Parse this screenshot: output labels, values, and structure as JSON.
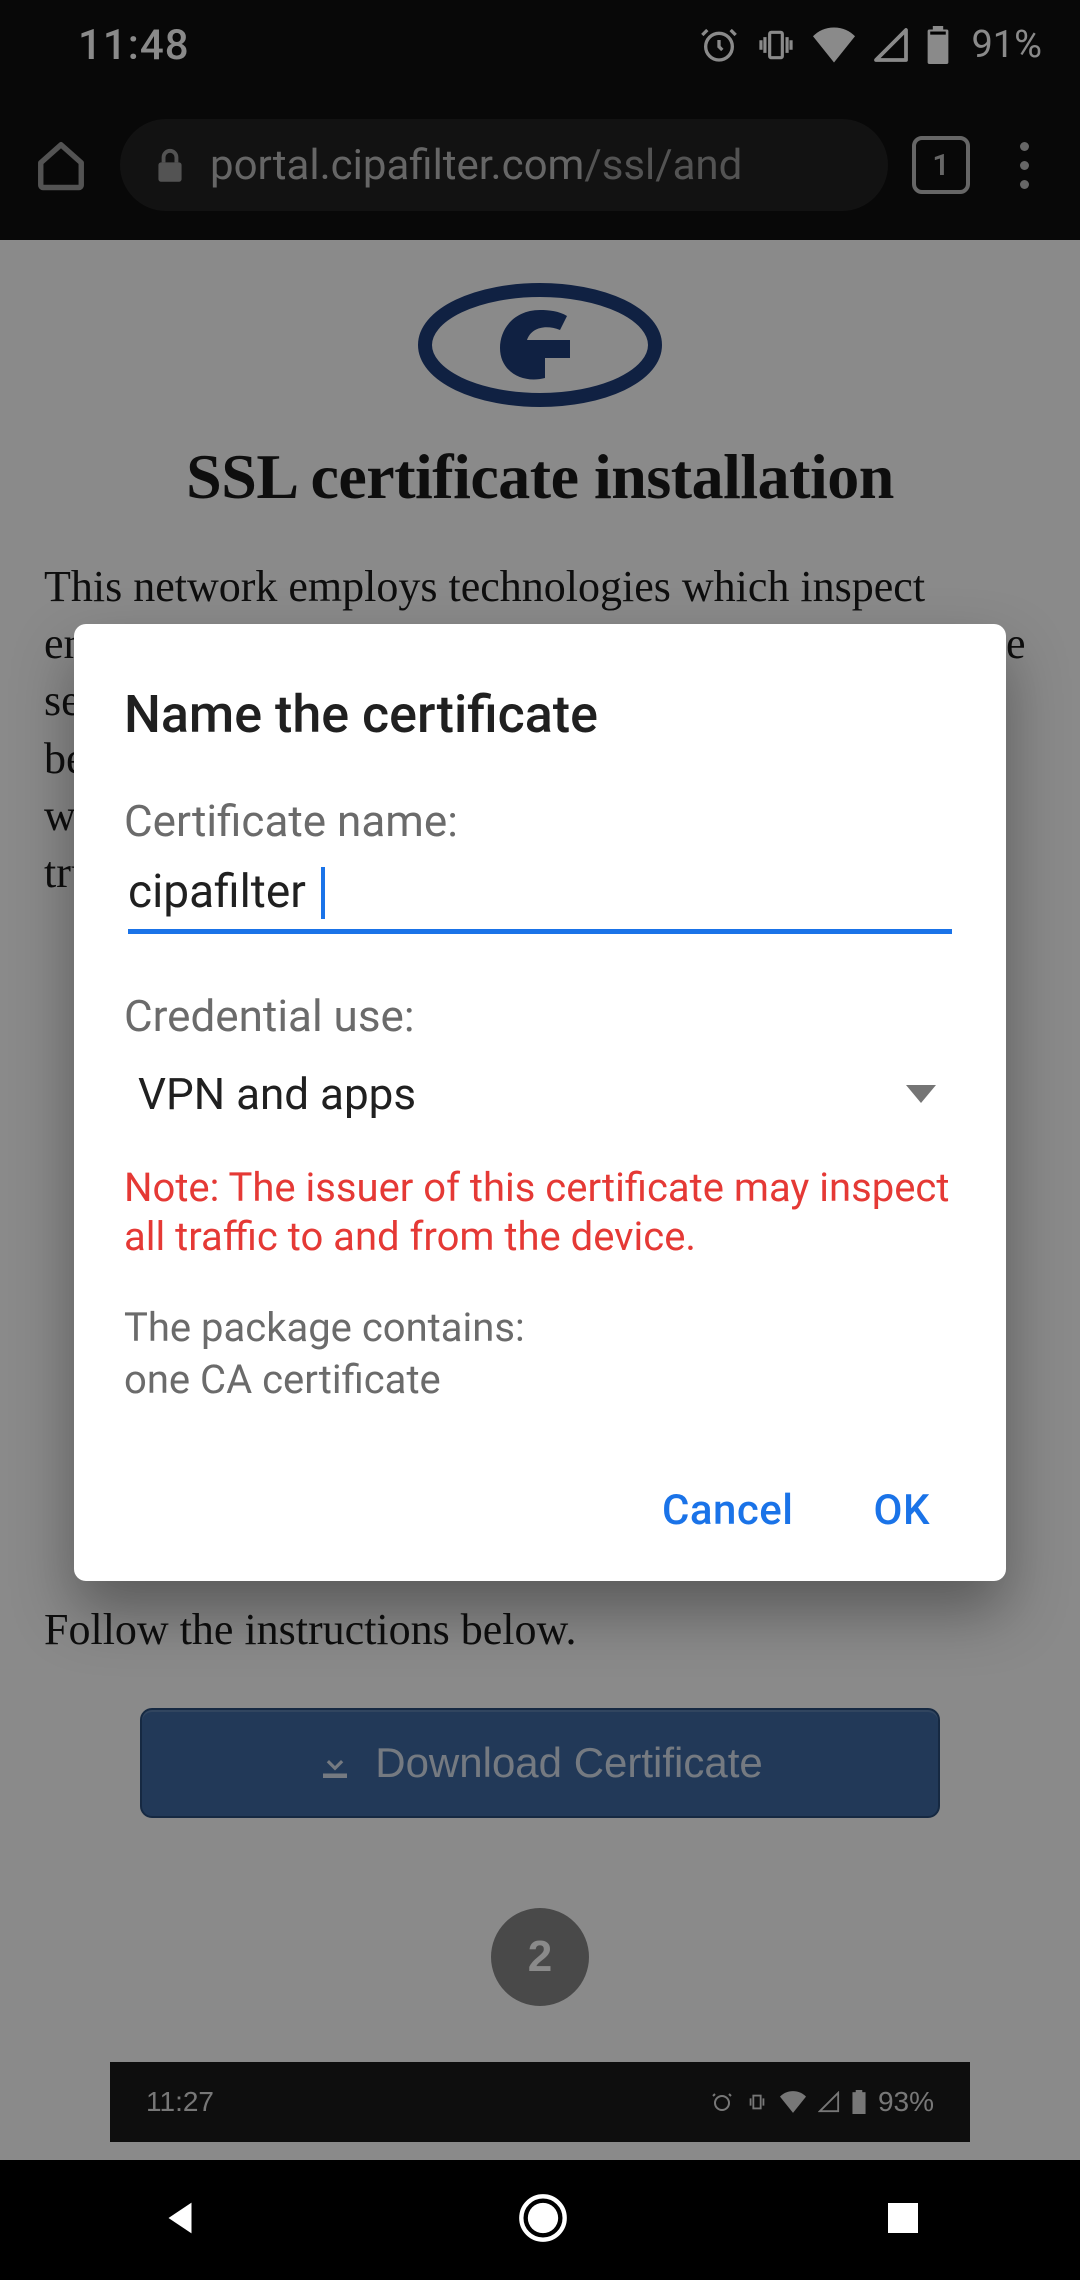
{
  "status": {
    "time": "11:48",
    "battery": "91%"
  },
  "browser": {
    "url_host": "portal.cipafilter.com",
    "url_path": "/ssl/and",
    "tab_count": "1"
  },
  "page": {
    "heading": "SSL certificate installation",
    "lead": "This network employs technologies which inspect encrypted connections. These connections will generate security warnings when the connected device has not been properly configured. These configuration steps will ensure your connected device is configured for trusted support of these technologies.",
    "follow": "Follow the instructions below.",
    "download_label": "Download Certificate",
    "step2": "2",
    "embed_time": "11:27",
    "embed_batt": "93%"
  },
  "dialog": {
    "title": "Name the certificate",
    "name_label": "Certificate name:",
    "name_value": "cipafilter",
    "use_label": "Credential use:",
    "use_value": "VPN and apps",
    "warning": "Note: The issuer of this certificate may inspect all traffic to and from the device.",
    "package_label": "The package contains:",
    "package_value": "one CA certificate",
    "cancel": "Cancel",
    "ok": "OK"
  }
}
